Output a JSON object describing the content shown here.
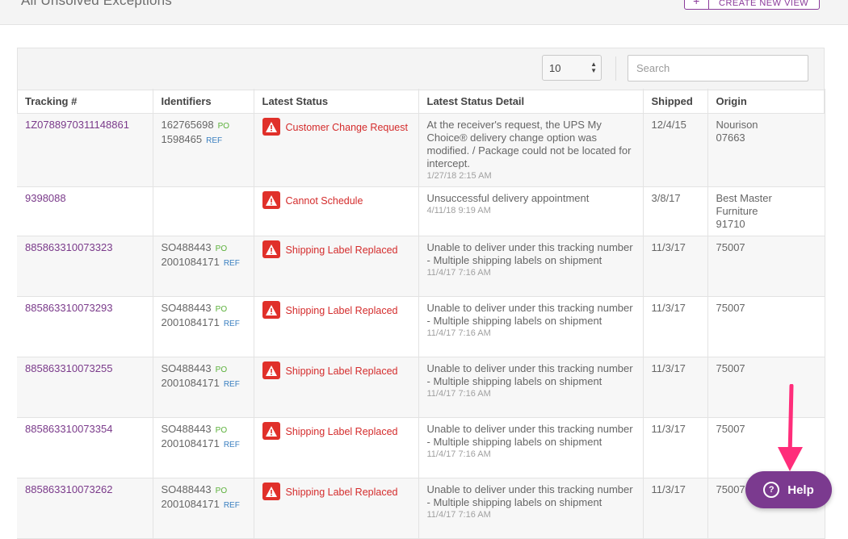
{
  "header": {
    "title": "All Unsolved Exceptions",
    "create_view_label": "CREATE NEW VIEW",
    "create_view_icon": "plus-icon"
  },
  "toolbar": {
    "page_size": "10",
    "search_placeholder": "Search"
  },
  "columns": [
    "Tracking #",
    "Identifiers",
    "Latest Status",
    "Latest Status Detail",
    "Shipped",
    "Origin"
  ],
  "rows": [
    {
      "tracking": "1Z0788970311148861",
      "ids": [
        {
          "value": "162765698",
          "tag": "PO"
        },
        {
          "value": "1598465",
          "tag": "REF"
        }
      ],
      "status": "Customer Change Request",
      "detail": "At the receiver's request, the UPS My Choice® delivery change option was modified. / Package could not be located for intercept.",
      "detail_time": "1/27/18 2:15 AM",
      "shipped": "12/4/15",
      "origin": [
        "Nourison",
        "07663"
      ]
    },
    {
      "tracking": "9398088",
      "ids": [],
      "status": "Cannot Schedule",
      "detail": "Unsuccessful delivery appointment",
      "detail_time": "4/11/18 9:19 AM",
      "shipped": "3/8/17",
      "origin": [
        "Best Master Furniture",
        "91710"
      ]
    },
    {
      "tracking": "885863310073323",
      "ids": [
        {
          "value": "SO488443",
          "tag": "PO"
        },
        {
          "value": "2001084171",
          "tag": "REF"
        }
      ],
      "status": "Shipping Label Replaced",
      "detail": "Unable to deliver under this tracking number - Multiple shipping labels on shipment",
      "detail_time": "11/4/17 7:16 AM",
      "shipped": "11/3/17",
      "origin": [
        "75007"
      ]
    },
    {
      "tracking": "885863310073293",
      "ids": [
        {
          "value": "SO488443",
          "tag": "PO"
        },
        {
          "value": "2001084171",
          "tag": "REF"
        }
      ],
      "status": "Shipping Label Replaced",
      "detail": "Unable to deliver under this tracking number - Multiple shipping labels on shipment",
      "detail_time": "11/4/17 7:16 AM",
      "shipped": "11/3/17",
      "origin": [
        "75007"
      ]
    },
    {
      "tracking": "885863310073255",
      "ids": [
        {
          "value": "SO488443",
          "tag": "PO"
        },
        {
          "value": "2001084171",
          "tag": "REF"
        }
      ],
      "status": "Shipping Label Replaced",
      "detail": "Unable to deliver under this tracking number - Multiple shipping labels on shipment",
      "detail_time": "11/4/17 7:16 AM",
      "shipped": "11/3/17",
      "origin": [
        "75007"
      ]
    },
    {
      "tracking": "885863310073354",
      "ids": [
        {
          "value": "SO488443",
          "tag": "PO"
        },
        {
          "value": "2001084171",
          "tag": "REF"
        }
      ],
      "status": "Shipping Label Replaced",
      "detail": "Unable to deliver under this tracking number - Multiple shipping labels on shipment",
      "detail_time": "11/4/17 7:16 AM",
      "shipped": "11/3/17",
      "origin": [
        "75007"
      ]
    },
    {
      "tracking": "885863310073262",
      "ids": [
        {
          "value": "SO488443",
          "tag": "PO"
        },
        {
          "value": "2001084171",
          "tag": "REF"
        }
      ],
      "status": "Shipping Label Replaced",
      "detail": "Unable to deliver under this tracking number - Multiple shipping labels on shipment",
      "detail_time": "11/4/17 7:16 AM",
      "shipped": "11/3/17",
      "origin": [
        "75007"
      ]
    }
  ],
  "help": {
    "label": "Help",
    "icon": "question-circle-icon"
  },
  "colors": {
    "accent": "#7b3a8f",
    "link": "#7a3a8a",
    "alert": "#e0302a",
    "po_tag": "#5bb03a",
    "ref_tag": "#3a7fc0",
    "annotation_arrow": "#ff2d7a"
  }
}
